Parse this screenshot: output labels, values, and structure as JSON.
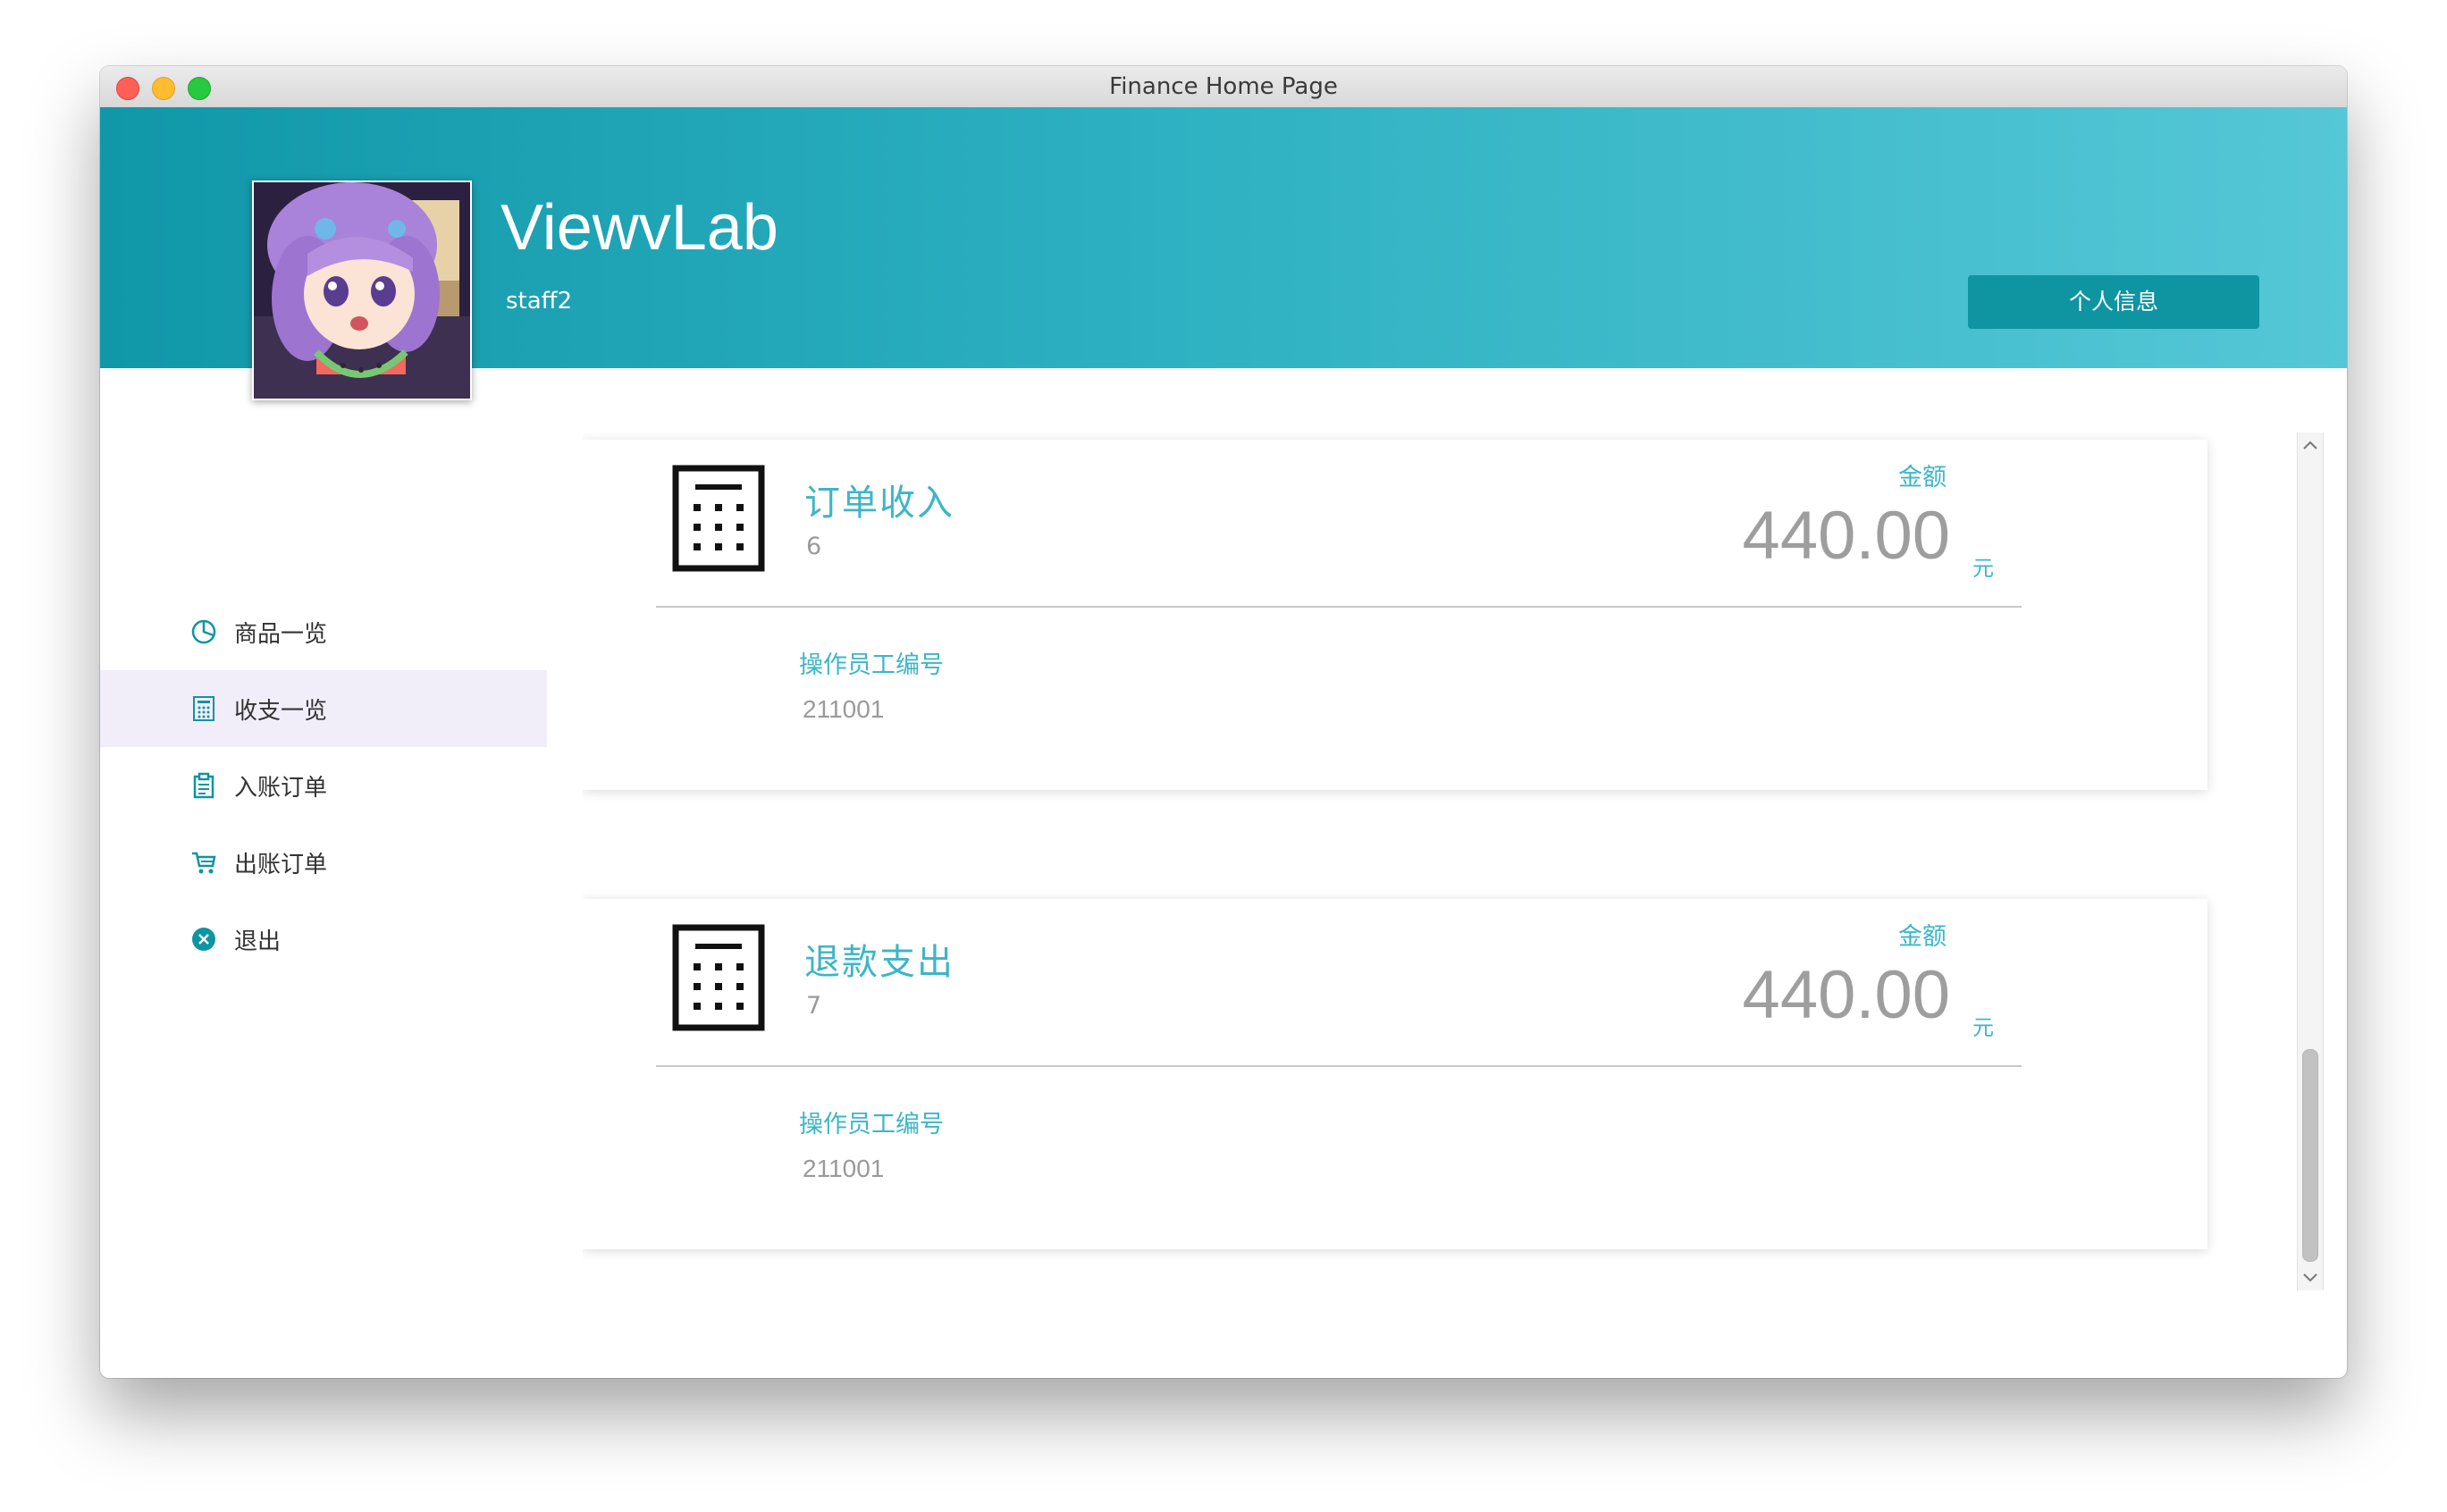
{
  "window": {
    "title": "Finance Home Page"
  },
  "header": {
    "app_name": "ViewvLab",
    "username": "staff2",
    "profile_button": "个人信息"
  },
  "sidebar": {
    "items": [
      {
        "label": "商品一览",
        "icon": "pie-chart-icon"
      },
      {
        "label": "收支一览",
        "icon": "calculator-icon",
        "active": true
      },
      {
        "label": "入账订单",
        "icon": "clipboard-icon"
      },
      {
        "label": "出账订单",
        "icon": "cart-icon"
      },
      {
        "label": "退出",
        "icon": "close-circle-icon"
      }
    ]
  },
  "cards": [
    {
      "title": "订单收入",
      "id": "6",
      "amount_label": "金额",
      "amount": "440.00",
      "unit": "元",
      "operator_label": "操作员工编号",
      "operator_id": "211001"
    },
    {
      "title": "退款支出",
      "id": "7",
      "amount_label": "金额",
      "amount": "440.00",
      "unit": "元",
      "operator_label": "操作员工编号",
      "operator_id": "211001"
    }
  ],
  "colors": {
    "accent": "#3cb6c7",
    "header_start": "#1097a8",
    "header_end": "#55c7d6",
    "button": "#0f94a2",
    "active_nav": "#f1eefa"
  }
}
